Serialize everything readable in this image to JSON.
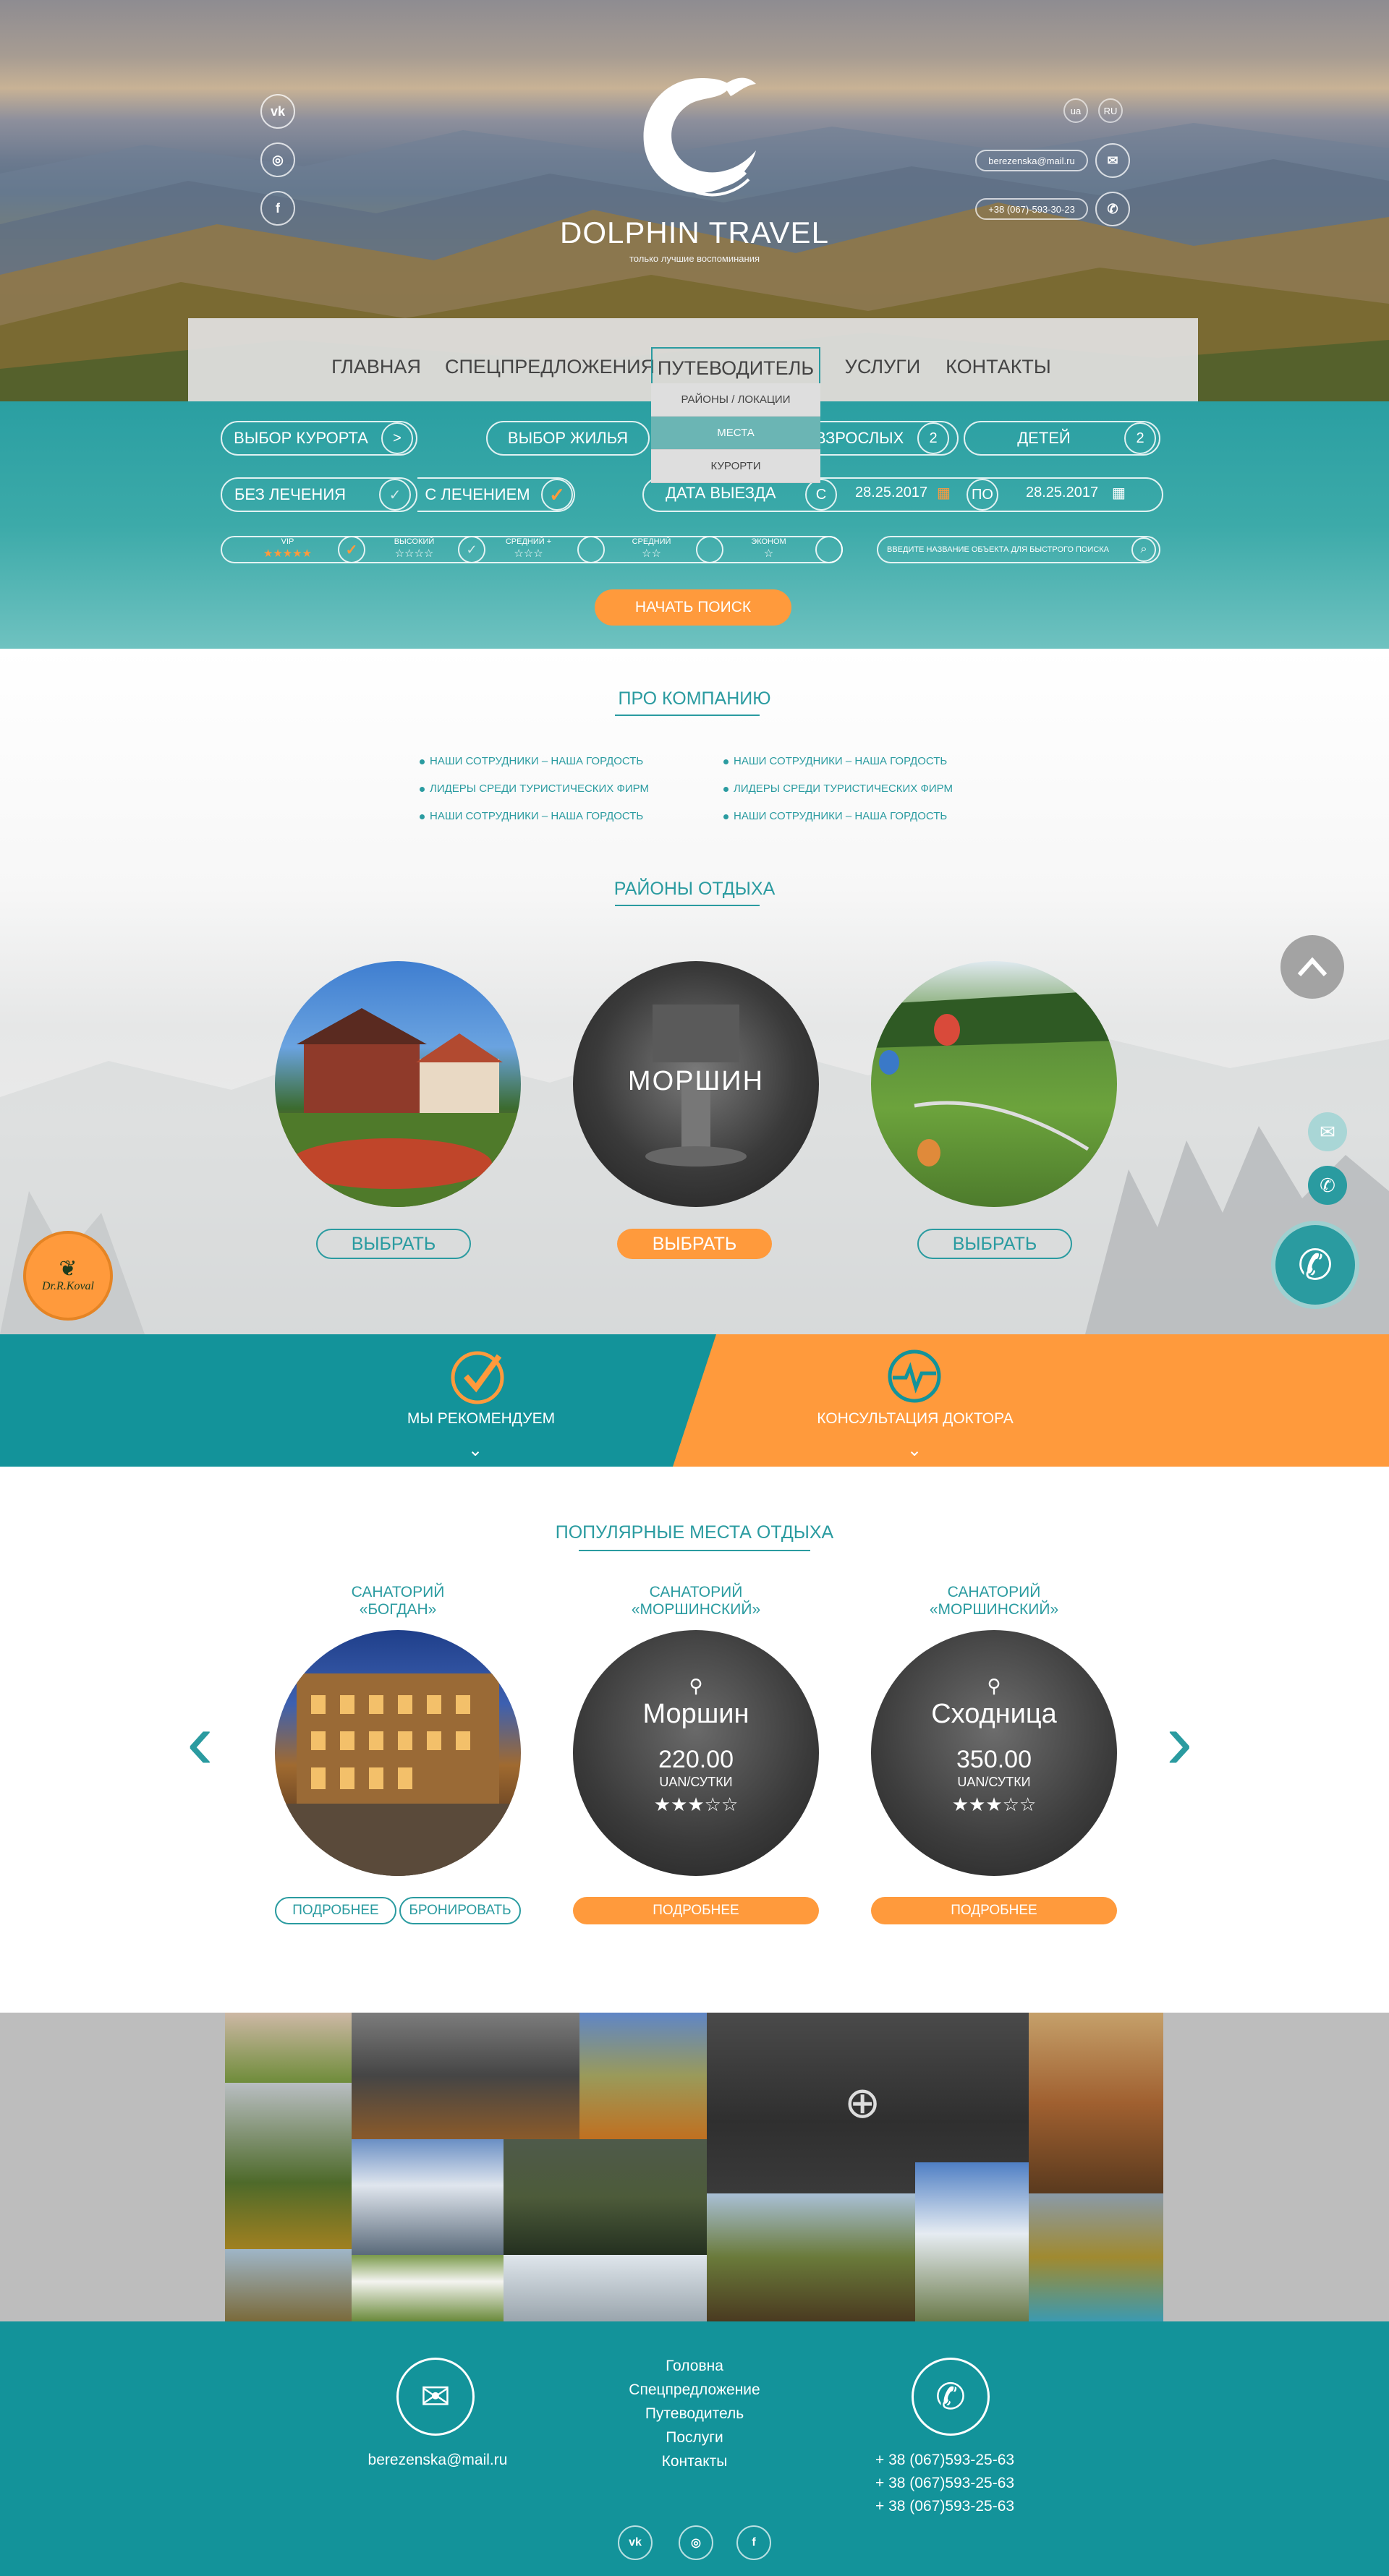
{
  "brand": {
    "name": "DOLPHIN TRAVEL",
    "tagline": "только лучшие воспоминания"
  },
  "header": {
    "social": {
      "vk": "vk",
      "instagram": "◎",
      "facebook": "f"
    },
    "lang_ua": "ua",
    "lang_ru": "RU",
    "email": "berezenska@mail.ru",
    "phone": "+38 (067)-593-30-23"
  },
  "nav": {
    "items": [
      "ГЛАВНАЯ",
      "СПЕЦПРЕДЛОЖЕНИЯ",
      "ПУТЕВОДИТЕЛЬ",
      "УСЛУГИ",
      "КОНТАКТЫ"
    ],
    "active": "ПУТЕВОДИТЕЛЬ",
    "dropdown": [
      "РАЙОНЫ / ЛОКАЦИИ",
      "МЕСТА",
      "КУРОРТИ"
    ]
  },
  "search": {
    "resort": "ВЫБОР КУРОРТА",
    "resort_arrow": ">",
    "housing": "ВЫБОР ЖИЛЬЯ",
    "adults": "ВЗРОСЛЫХ",
    "adults_count": "2",
    "children": "ДЕТЕЙ",
    "children_count": "2",
    "no_treatment": "БЕЗ ЛЕЧЕНИЯ",
    "with_treatment": "С ЛЕЧЕНИЕМ",
    "checkmark": "✓",
    "departure": "ДАТА ВЫЕЗДА",
    "from_label": "С",
    "from_date": "28.25.2017",
    "to_label": "ПО",
    "to_date": "28.25.2017",
    "classes": [
      {
        "name": "VIP",
        "stars": "★★★★★"
      },
      {
        "name": "ВЫСОКИЙ",
        "stars": "☆☆☆☆"
      },
      {
        "name": "СРЕДНИЙ +",
        "stars": "☆☆☆"
      },
      {
        "name": "СРЕДНИЙ",
        "stars": "☆☆"
      },
      {
        "name": "ЭКОНОМ",
        "stars": "☆"
      }
    ],
    "quick_placeholder": "ВВЕДИТЕ НАЗВАНИЕ ОБЪЕКТА ДЛЯ БЫСТРОГО ПОИСКА",
    "start_button": "НАЧАТЬ ПОИСК"
  },
  "about": {
    "title": "ПРО КОМПАНИЮ",
    "left": [
      "НАШИ СОТРУДНИКИ – НАША ГОРДОСТЬ",
      "ЛИДЕРЫ СРЕДИ ТУРИСТИЧЕСКИХ ФИРМ",
      "НАШИ СОТРУДНИКИ – НАША ГОРДОСТЬ"
    ],
    "right": [
      "НАШИ СОТРУДНИКИ – НАША ГОРДОСТЬ",
      "ЛИДЕРЫ СРЕДИ ТУРИСТИЧЕСКИХ ФИРМ",
      "НАШИ СОТРУДНИКИ – НАША ГОРДОСТЬ"
    ]
  },
  "regions": {
    "title": "РАЙОНЫ ОТДЫХА",
    "items": [
      {
        "name": "",
        "button": "ВЫБРАТЬ"
      },
      {
        "name": "МОРШИН",
        "button": "ВЫБРАТЬ"
      },
      {
        "name": "",
        "button": "ВЫБРАТЬ"
      }
    ]
  },
  "widgets": {
    "doctor_badge": "Dr.R.Koval"
  },
  "banners": {
    "recommend": "МЫ РЕКОМЕНДУЕМ",
    "consult": "КОНСУЛЬТАЦИЯ ДОКТОРА"
  },
  "popular": {
    "title": "ПОПУЛЯРНЫЕ МЕСТА ОТДЫХА",
    "items": [
      {
        "name_line1": "САНАТОРИЙ",
        "name_line2": "«БОГДАН»",
        "city": "",
        "price": "",
        "unit": "",
        "stars": "",
        "btn1": "ПОДРОБНЕЕ",
        "btn2": "БРОНИРОВАТЬ"
      },
      {
        "name_line1": "САНАТОРИЙ",
        "name_line2": "«МОРШИНСКИЙ»",
        "city": "Моршин",
        "price": "220.00",
        "unit": "UAN/СУТКИ",
        "stars": "★★★☆☆",
        "btn1": "ПОДРОБНЕЕ"
      },
      {
        "name_line1": "САНАТОРИЙ",
        "name_line2": "«МОРШИНСКИЙ»",
        "city": "Сходница",
        "price": "350.00",
        "unit": "UAN/СУТКИ",
        "stars": "★★★☆☆",
        "btn1": "ПОДРОБНЕЕ"
      }
    ],
    "prev": "‹",
    "next": "›"
  },
  "footer": {
    "email": "berezenska@mail.ru",
    "nav": [
      "Головна",
      "Спецпредложение",
      "Путеводитель",
      "Послуги",
      "Контакты"
    ],
    "phones": [
      "+ 38 (067)593-25-63",
      "+ 38 (067)593-25-63",
      "+ 38 (067)593-25-63"
    ]
  },
  "colors": {
    "teal": "#2a9ba0",
    "orange": "#ff9a3c",
    "footer": "#13939a"
  }
}
